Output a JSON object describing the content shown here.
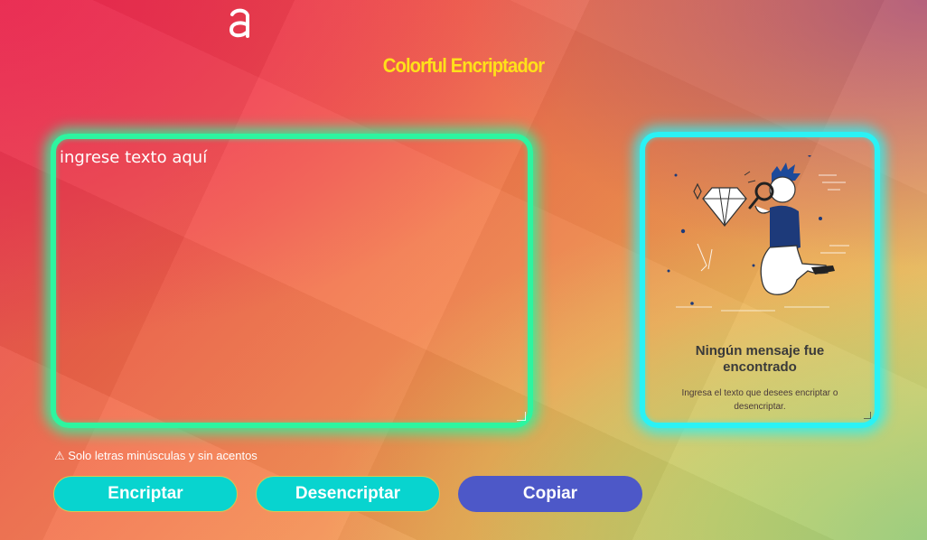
{
  "header": {
    "logo_icon": "alura-a-logo-icon",
    "title": "Colorful Encriptador"
  },
  "input": {
    "placeholder": "ingrese texto aquí"
  },
  "output": {
    "illustration_icon": "person-with-magnifier-and-diamond-illustration",
    "empty_title": "Ningún mensaje fue encontrado",
    "empty_description": "Ingresa el texto que desees encriptar o desencriptar."
  },
  "hint": {
    "icon": "warning-icon",
    "text": "⚠ Solo letras minúsculas y sin acentos"
  },
  "buttons": {
    "encrypt_label": "Encriptar",
    "decrypt_label": "Desencriptar",
    "copy_label": "Copiar"
  },
  "colors": {
    "title": "#ffe01a",
    "input_border": "#2df5a0",
    "output_border": "#2af2f5",
    "primary_button": "#08d4cf",
    "copy_button": "#4d58c8"
  }
}
